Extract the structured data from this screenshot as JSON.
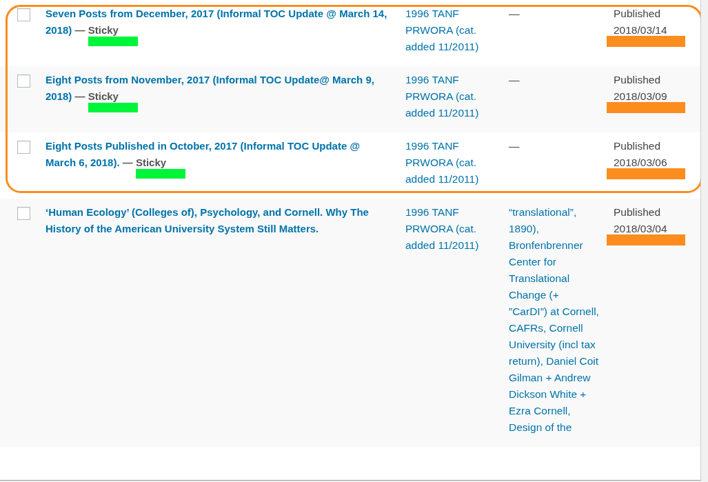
{
  "posts": [
    {
      "checked": false,
      "title": "Seven Posts from December, 2017 (Informal TOC Update @ March 14, 2018)",
      "state_separator": "—",
      "state": "Sticky",
      "state_marked": true,
      "categories": "1996 TANF PRWORA (cat. added 11/2011)",
      "tags": "—",
      "tags_linked": false,
      "status": "Published",
      "date": "2018/03/14",
      "date_marked": true,
      "circled": true
    },
    {
      "checked": false,
      "title": "Eight Posts from November, 2017 (Informal TOC Update@ March 9, 2018)",
      "state_separator": "—",
      "state": "Sticky",
      "state_marked": true,
      "categories": "1996 TANF PRWORA (cat. added 11/2011)",
      "tags": "—",
      "tags_linked": false,
      "status": "Published",
      "date": "2018/03/09",
      "date_marked": true,
      "circled": true
    },
    {
      "checked": false,
      "title": "Eight Posts Published in October, 2017 (Informal TOC Update @ March 6, 2018).",
      "state_separator": "—",
      "state": "Sticky",
      "state_marked": true,
      "categories": "1996 TANF PRWORA (cat. added 11/2011)",
      "tags": "—",
      "tags_linked": false,
      "status": "Published",
      "date": "2018/03/06",
      "date_marked": true,
      "circled": true
    },
    {
      "checked": false,
      "title": "‘Human Ecology’ (Colleges of), Psychology, and Cornell. Why The History of the American University System Still Matters.",
      "categories": "1996 TANF PRWORA (cat. added 11/2011)",
      "tags": "“translational”, 1890), Bronfenbrenner Center for Translational Change (+ ”CarDI”) at Cornell, CAFRs, Cornell University (incl tax return), Daniel Coit Gilman + Andrew Dickson White + Ezra Cornell, Design of the",
      "tags_linked": true,
      "status": "Published",
      "date": "2018/03/04",
      "date_marked": true,
      "circled": false
    }
  ]
}
